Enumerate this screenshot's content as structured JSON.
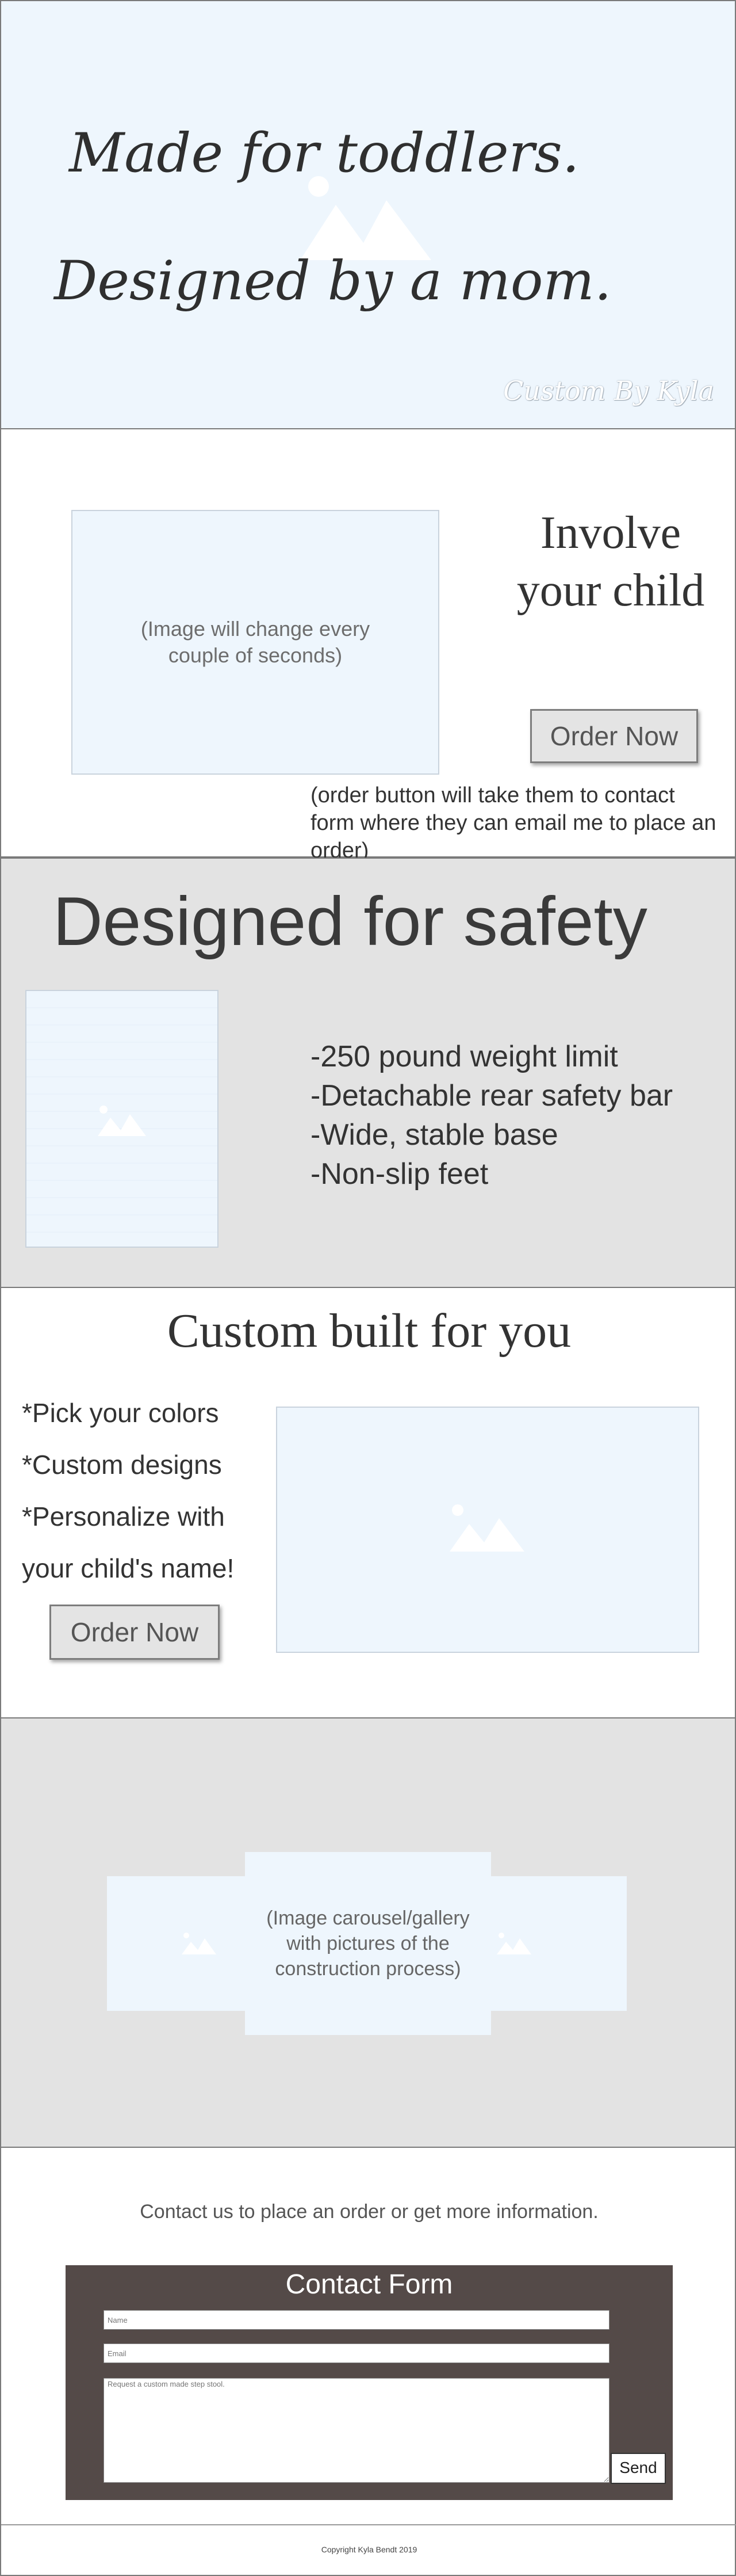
{
  "hero": {
    "line_1": "Made for toddlers.",
    "line_2": "Designed by a mom.",
    "signature": "Custom By Kyla",
    "background_color": "#eef6fd"
  },
  "involve": {
    "image_placeholder": "(Image will change every couple of seconds)",
    "heading": "Involve your child",
    "order_button": "Order Now",
    "note": "(order button will take them to contact form where they can email me to place an order)"
  },
  "safety": {
    "heading": "Designed for safety",
    "features": [
      "-250 pound weight limit",
      "-Detachable rear safety bar",
      "-Wide, stable base",
      "-Non-slip feet"
    ],
    "background_color": "#e3e3e3"
  },
  "custom": {
    "heading": "Custom built for  you",
    "features": [
      "*Pick your colors",
      "*Custom designs",
      "*Personalize with",
      "your child's name!"
    ],
    "order_button": "Order Now"
  },
  "gallery": {
    "center_text": "(Image carousel/gallery with pictures of the construction process)"
  },
  "contact": {
    "intro": "Contact us to place an order or get more information.",
    "form_title": "Contact Form",
    "name_placeholder": "Name",
    "email_placeholder": "Email",
    "message_placeholder": "Request a custom made step stool.",
    "send_button": "Send",
    "form_color": "#544a48"
  },
  "footer": {
    "copyright": "Copyright Kyla Bendt 2019"
  }
}
